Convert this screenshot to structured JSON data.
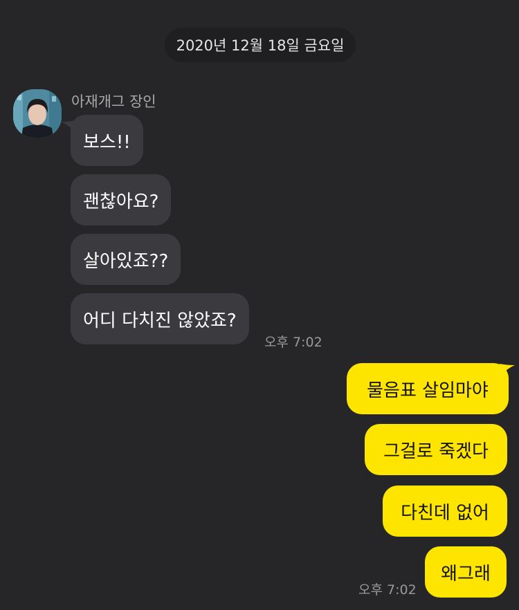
{
  "date_divider": "2020년 12월 18일 금요일",
  "incoming": {
    "sender_name": "아재개그 장인",
    "messages": [
      "보스!!",
      "괜찮아요?",
      "살아있죠??",
      "어디 다치진 않았죠?"
    ],
    "time": "오후 7:02"
  },
  "outgoing": {
    "messages": [
      "물음표 살임마야",
      "그걸로 죽겠다",
      "다친데 없어",
      "왜그래"
    ],
    "time": "오후 7:02"
  },
  "colors": {
    "background": "#262629",
    "incoming_bubble": "#3b3b3f",
    "outgoing_bubble": "#fee500"
  }
}
